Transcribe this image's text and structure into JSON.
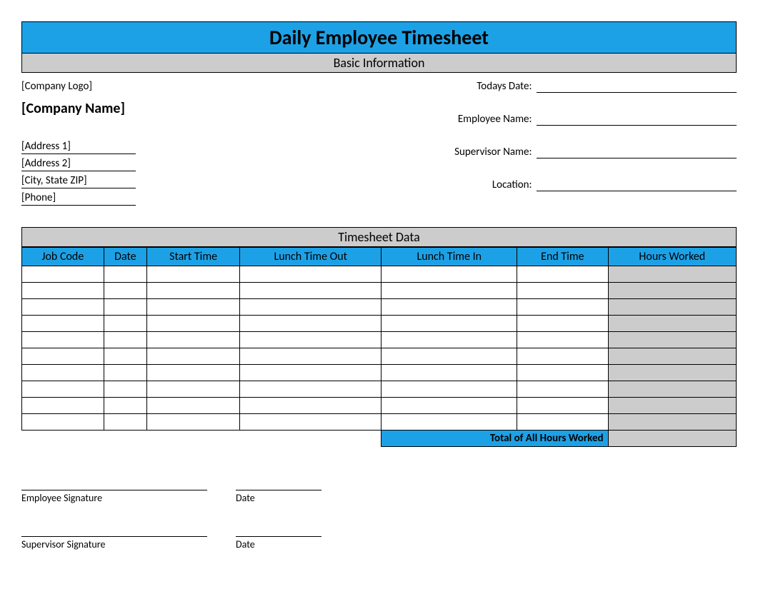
{
  "title": "Daily Employee Timesheet",
  "sections": {
    "basic": "Basic Information",
    "data": "Timesheet Data"
  },
  "company": {
    "logo": "[Company Logo]",
    "name": "[Company Name]",
    "address1": "[Address 1]",
    "address2": "[Address 2]",
    "city_state_zip": "[City, State ZIP]",
    "phone": "[Phone]"
  },
  "info_labels": {
    "todays_date": "Todays Date:",
    "employee_name": "Employee Name:",
    "supervisor_name": "Supervisor Name:",
    "location": "Location:"
  },
  "columns": {
    "job_code": "Job Code",
    "date": "Date",
    "start_time": "Start Time",
    "lunch_out": "Lunch Time Out",
    "lunch_in": "Lunch Time In",
    "end_time": "End Time",
    "hours_worked": "Hours Worked"
  },
  "total_label": "Total of All Hours Worked",
  "signatures": {
    "employee": "Employee Signature",
    "supervisor": "Supervisor Signature",
    "date": "Date"
  }
}
